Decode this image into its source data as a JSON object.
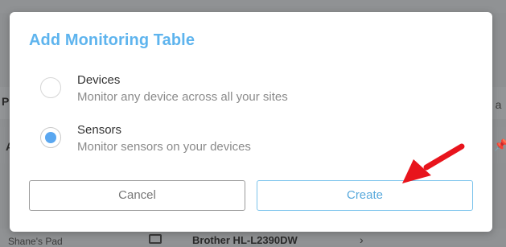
{
  "background": {
    "fragments": {
      "letter_p": "P",
      "letter_a": "A",
      "trailing_text": "e a",
      "device_name": "Shane's Pad",
      "printer_model": "Brother HL-L2390DW"
    }
  },
  "modal": {
    "title": "Add Monitoring Table",
    "options": [
      {
        "label": "Devices",
        "description": "Monitor any device across all your sites",
        "selected": false
      },
      {
        "label": "Sensors",
        "description": "Monitor sensors on your devices",
        "selected": true
      }
    ],
    "cancel_label": "Cancel",
    "create_label": "Create"
  },
  "colors": {
    "accent": "#5eb4ee",
    "radio_selected": "#5aa7f0",
    "arrow": "#e8141c"
  }
}
